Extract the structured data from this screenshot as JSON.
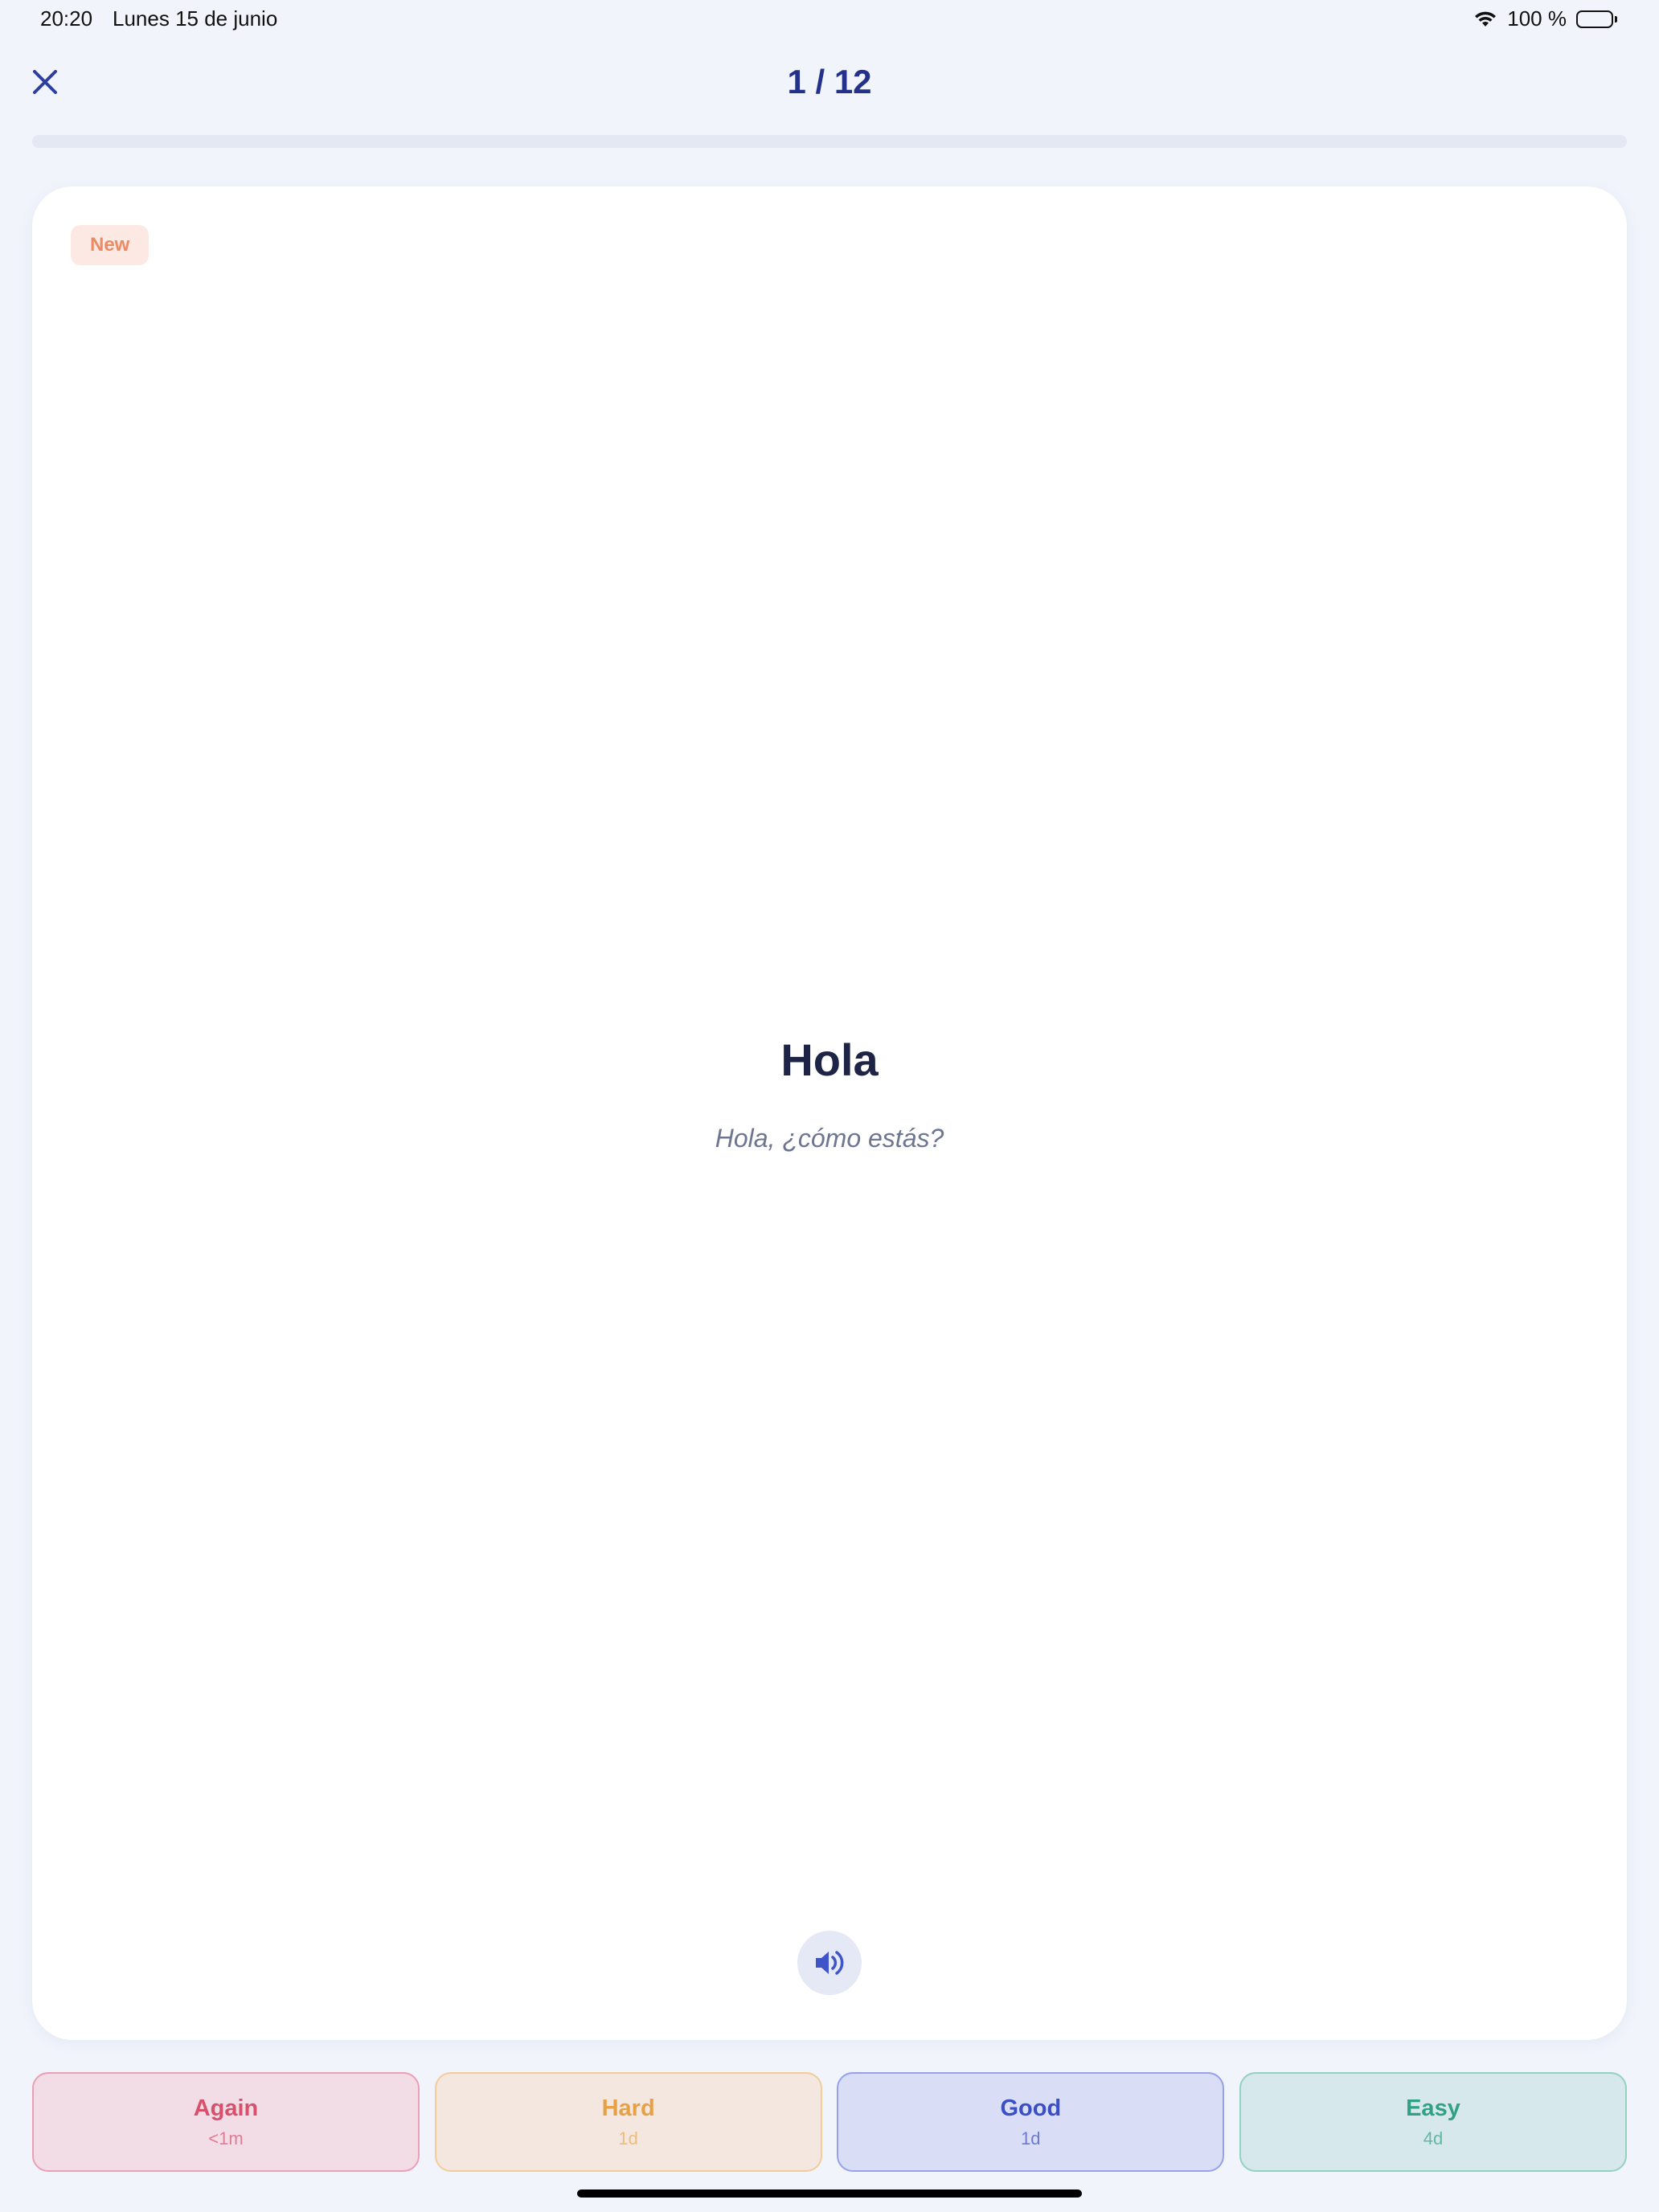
{
  "status_bar": {
    "time": "20:20",
    "date": "Lunes 15 de junio",
    "battery_text": "100 %",
    "battery_level": 1.0
  },
  "header": {
    "counter": "1 / 12",
    "close_icon": "close-icon"
  },
  "progress": {
    "current": 1,
    "total": 12,
    "fraction": 0.0
  },
  "card": {
    "badge": "New",
    "word": "Hola",
    "example": "Hola, ¿cómo estás?",
    "audio_icon": "speaker-icon"
  },
  "ratings": [
    {
      "label": "Again",
      "interval": "<1m"
    },
    {
      "label": "Hard",
      "interval": "1d"
    },
    {
      "label": "Good",
      "interval": "1d"
    },
    {
      "label": "Easy",
      "interval": "4d"
    }
  ],
  "colors": {
    "accent": "#24318a",
    "background": "#f1f4fb",
    "again": "#d9506d",
    "hard": "#e8a045",
    "good": "#3a4fc5",
    "easy": "#30a283"
  }
}
